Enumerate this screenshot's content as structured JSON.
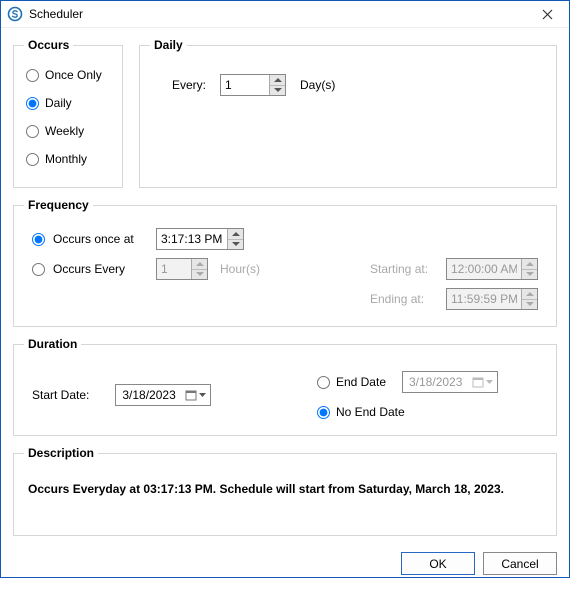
{
  "window": {
    "title": "Scheduler"
  },
  "occurs": {
    "legend": "Occurs",
    "options": {
      "once": "Once Only",
      "daily": "Daily",
      "weekly": "Weekly",
      "monthly": "Monthly"
    },
    "selected": "daily"
  },
  "daily": {
    "legend": "Daily",
    "every_label": "Every:",
    "every_value": "1",
    "day_label": "Day(s)"
  },
  "frequency": {
    "legend": "Frequency",
    "occurs_once_label": "Occurs once at",
    "occurs_once_time": "3:17:13 PM",
    "occurs_every_label": "Occurs Every",
    "occurs_every_value": "1",
    "hours_label": "Hour(s)",
    "starting_at_label": "Starting at:",
    "starting_at_value": "12:00:00 AM",
    "ending_at_label": "Ending at:",
    "ending_at_value": "11:59:59 PM",
    "selected": "once"
  },
  "duration": {
    "legend": "Duration",
    "start_date_label": "Start Date:",
    "start_date_value": "3/18/2023",
    "end_date_label": "End Date",
    "end_date_value": "3/18/2023",
    "no_end_date_label": "No End Date",
    "selected": "noend"
  },
  "description": {
    "legend": "Description",
    "text": "Occurs Everyday at 03:17:13 PM. Schedule will start from Saturday, March 18, 2023."
  },
  "buttons": {
    "ok": "OK",
    "cancel": "Cancel"
  }
}
